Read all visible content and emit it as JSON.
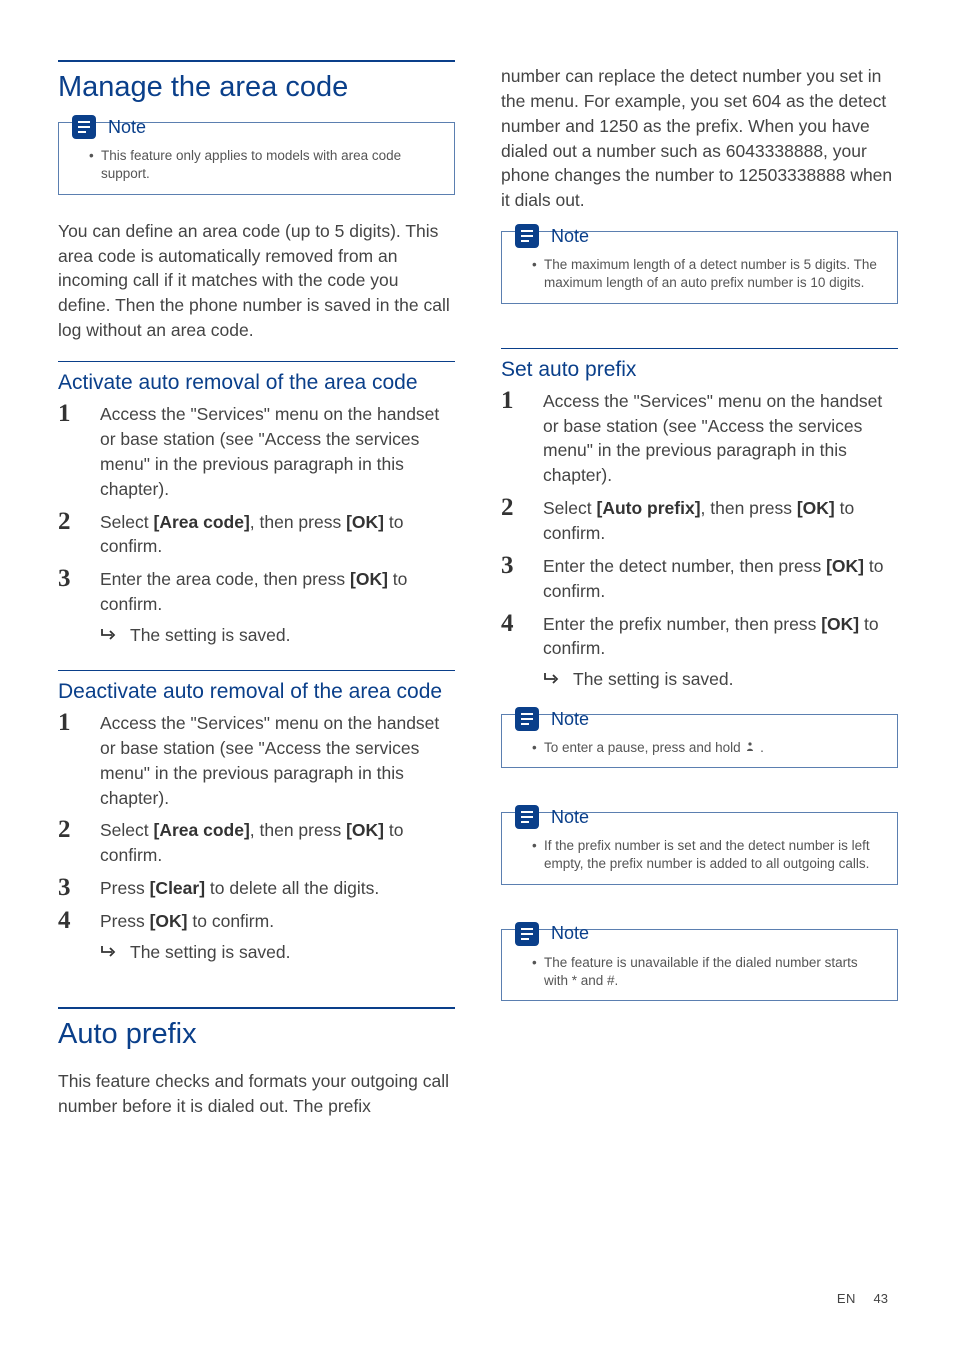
{
  "left": {
    "h1a": "Manage the area code",
    "note1_label": "Note",
    "note1_item": "This feature only applies to models with area code support.",
    "intro": "You can define an area code (up to 5 digits). This area code is automatically removed from an incoming call if it matches with the code you define. Then the phone number is saved in the call log without an area code.",
    "h2a": "Activate auto removal of the area code",
    "s1_1": "Access the \"Services\" menu on the handset or base station (see \"Access the services menu\" in the previous paragraph in this chapter).",
    "s1_2a": "Select ",
    "s1_2b": "[Area code]",
    "s1_2c": ", then press ",
    "s1_2d": "[OK]",
    "s1_2e": " to confirm.",
    "s1_3a": "Enter the area code, then press ",
    "s1_3b": "[OK]",
    "s1_3c": " to confirm.",
    "res1": "The setting is saved.",
    "h2b": "Deactivate auto removal of the area code",
    "s2_1": "Access the \"Services\" menu on the handset or base station (see \"Access the services menu\" in the previous paragraph in this chapter).",
    "s2_2a": "Select ",
    "s2_2b": "[Area code]",
    "s2_2c": ", then press ",
    "s2_2d": "[OK]",
    "s2_2e": " to confirm.",
    "s2_3a": "Press ",
    "s2_3b": "[Clear]",
    "s2_3c": " to delete all the digits.",
    "s2_4a": "Press ",
    "s2_4b": "[OK]",
    "s2_4c": " to confirm.",
    "res2": "The setting is saved.",
    "h1b": "Auto prefix",
    "prefix_intro": "This feature checks and formats your outgoing call number before it is dialed out. The prefix "
  },
  "right": {
    "cont": "number can replace the detect number you set in the menu. For example, you set 604 as the detect number and 1250 as the prefix. When you have dialed out a number such as 6043338888, your phone changes the number to 12503338888 when it dials out.",
    "note2_label": "Note",
    "note2_item": "The maximum length of a detect number is 5 digits. The maximum length of an auto prefix number is 10 digits.",
    "h2c": "Set auto prefix",
    "s3_1": "Access the \"Services\" menu on the handset or base station (see \"Access the services menu\" in the previous paragraph in this chapter).",
    "s3_2a": "Select ",
    "s3_2b": "[Auto prefix]",
    "s3_2c": ", then press ",
    "s3_2d": "[OK]",
    "s3_2e": " to confirm.",
    "s3_3a": "Enter the detect number, then press ",
    "s3_3b": "[OK]",
    "s3_3c": " to confirm.",
    "s3_4a": "Enter the prefix number, then press ",
    "s3_4b": "[OK]",
    "s3_4c": " to confirm.",
    "res3": "The setting is saved.",
    "note3_label": "Note",
    "note3_item": "To enter a pause, press and hold ",
    "note3_icon": "⁎",
    "note3_tail": " .",
    "note4_label": "Note",
    "note4_item": "If the prefix number is set and the detect number is left empty, the prefix number is added to all outgoing calls.",
    "note5_label": "Note",
    "note5_item": "The feature is unavailable if the dialed number starts with * and #."
  },
  "footer": {
    "lang": "EN",
    "page": "43"
  }
}
